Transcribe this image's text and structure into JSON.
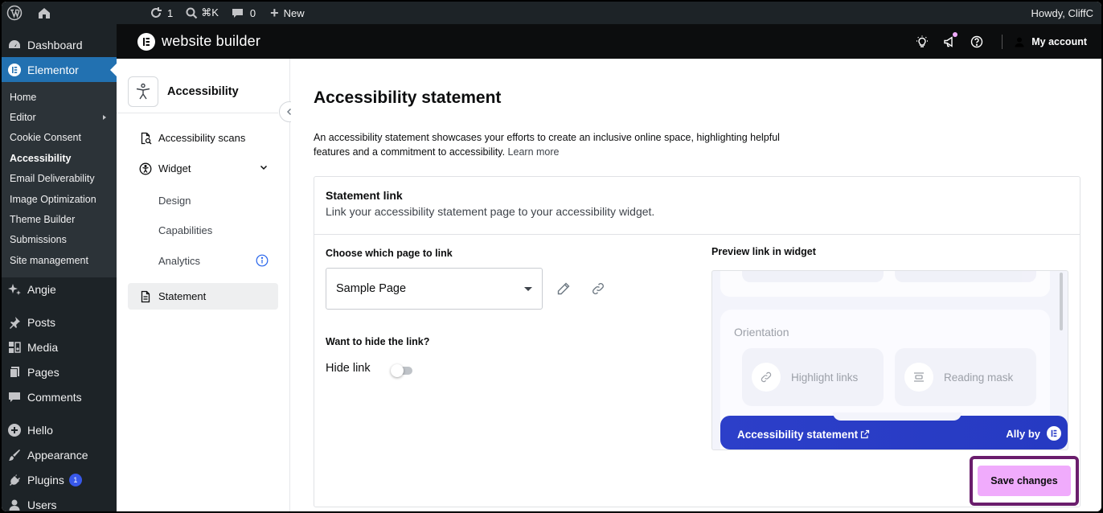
{
  "adminbar": {
    "updates_count": "1",
    "search_shortcut": "⌘K",
    "comments_count": "0",
    "new_label": "New",
    "howdy": "Howdy, CliffC"
  },
  "wpmenu": {
    "dashboard": "Dashboard",
    "elementor": "Elementor",
    "elementor_sub": [
      "Home",
      "Editor",
      "Cookie Consent",
      "Accessibility",
      "Email Deliverability",
      "Image Optimization",
      "Theme Builder",
      "Submissions",
      "Site management"
    ],
    "angie": "Angie",
    "posts": "Posts",
    "media": "Media",
    "pages": "Pages",
    "comments": "Comments",
    "hello": "Hello",
    "appearance": "Appearance",
    "plugins": "Plugins",
    "plugins_badge": "1",
    "users": "Users"
  },
  "header": {
    "title": "website builder",
    "account": "My account"
  },
  "plugin_nav": {
    "title": "Accessibility",
    "scans": "Accessibility scans",
    "widget": "Widget",
    "design": "Design",
    "capabilities": "Capabilities",
    "analytics": "Analytics",
    "statement": "Statement"
  },
  "main": {
    "title": "Accessibility statement",
    "description": "An accessibility statement showcases your efforts to create an inclusive online space, highlighting helpful features and a commitment to accessibility.",
    "learn_more": "Learn more",
    "card_title": "Statement link",
    "card_sub": "Link your accessibility statement page to your accessibility widget.",
    "choose_label": "Choose which page to link",
    "selected_page": "Sample Page",
    "hide_question": "Want to hide the link?",
    "hide_label": "Hide link",
    "hide_link_on": false,
    "preview_label": "Preview link in widget",
    "preview": {
      "orientation": "Orientation",
      "highlight_links": "Highlight links",
      "reading_mask": "Reading mask",
      "statement_link": "Accessibility statement",
      "ally_by": "Ally by"
    },
    "save_label": "Save changes"
  },
  "colors": {
    "wp_dark": "#1d2327",
    "wp_active": "#2271b1",
    "elementor_header": "#0c0d0e",
    "widget_bar": "#2c3fc9",
    "save_button": "#f0abfc",
    "highlight_border": "#6a1d6c"
  }
}
